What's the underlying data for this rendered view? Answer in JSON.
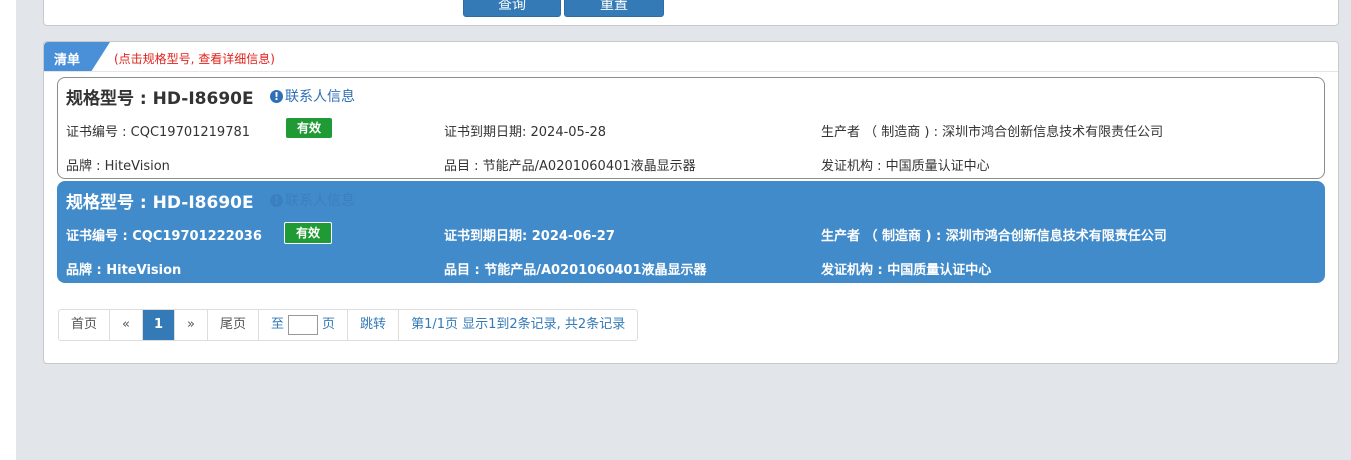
{
  "search_panel": {
    "query_label": "查询",
    "reset_label": "重置"
  },
  "list": {
    "tab_label": "清单",
    "hint": "(点击规格型号, 查看详细信息)"
  },
  "items": [
    {
      "model": "规格型号 : HD-I8690E",
      "contact": "联系人信息",
      "cert_no": "证书编号 : CQC19701219781",
      "status": "有效",
      "expiry": "证书到期日期: 2024-05-28",
      "producer": "生产者 （ 制造商 ) : 深圳市鸿合创新信息技术有限责任公司",
      "brand": "品牌 : HiteVision",
      "category": "品目 : 节能产品/A0201060401液晶显示器",
      "issuer": "发证机构 : 中国质量认证中心"
    },
    {
      "model": "规格型号 : HD-I8690E",
      "contact": "联系人信息",
      "cert_no": "证书编号 : CQC19701222036",
      "status": "有效",
      "expiry": "证书到期日期: 2024-06-27",
      "producer": "生产者 （ 制造商 ) : 深圳市鸿合创新信息技术有限责任公司",
      "brand": "品牌 : HiteVision",
      "category": "品目 : 节能产品/A0201060401液晶显示器",
      "issuer": "发证机构 : 中国质量认证中心"
    }
  ],
  "pagination": {
    "first": "首页",
    "prev": "«",
    "current": "1",
    "next": "»",
    "last": "尾页",
    "goto_prefix": "至",
    "goto_suffix": "页",
    "jump": "跳转",
    "summary": "第1/1页  显示1到2条记录, 共2条记录"
  },
  "colors": {
    "primary": "#337ab7",
    "selected_row": "#428bca",
    "badge_valid": "#1f9a34",
    "hint_red": "#e0221b"
  },
  "icons": {
    "contact": "info-circle-icon"
  }
}
